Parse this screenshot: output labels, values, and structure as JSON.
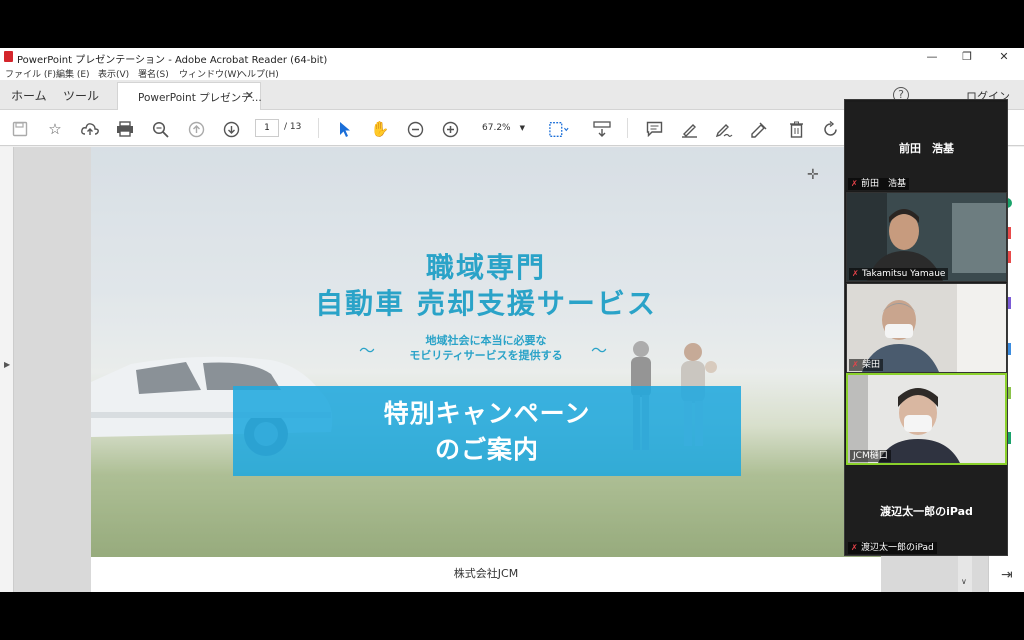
{
  "window": {
    "title": "PowerPoint プレゼンテーション - Adobe Acrobat Reader (64-bit)",
    "controls": {
      "minimize": "—",
      "restore": "❐",
      "close": "✕"
    }
  },
  "menu": [
    "ファイル (F)",
    "編集 (E)",
    "表示(V)",
    "署名(S)",
    "ウィンドウ(W)",
    "ヘルプ(H)"
  ],
  "tabs": {
    "home": "ホーム",
    "tools": "ツール",
    "document": "PowerPoint プレゼンテ...",
    "close": "✕",
    "help": "?",
    "login": "ログイン"
  },
  "toolbar": {
    "page_current": "1",
    "page_total": "/ 13",
    "zoom": "67.2%",
    "icons": [
      "save-icon",
      "star-icon",
      "cloud-upload-icon",
      "print-icon",
      "search-icon",
      "page-up-icon",
      "page-down-icon",
      "select-cursor-icon",
      "hand-icon",
      "zoom-out-icon",
      "zoom-in-icon",
      "fit-page-icon",
      "scroll-mode-icon",
      "comment-icon",
      "highlight-icon",
      "draw-icon",
      "sign-icon",
      "delete-icon",
      "rotate-icon"
    ]
  },
  "slide": {
    "title_line1": "職域専門",
    "title_line2": "自動車 売却支援サービス",
    "subtitle_line1": "地域社会に本当に必要な",
    "subtitle_line2": "モビリティサービスを提供する",
    "banner_line1": "特別キャンペーン",
    "banner_line2": "のご案内",
    "footer": "株式会社JCM",
    "accent_color": "#2aa3c8",
    "banner_color": "#21a8de"
  },
  "participants": [
    {
      "center_name": "前田　浩基",
      "label": "前田　浩基",
      "video": false,
      "muted": true
    },
    {
      "label": "Takamitsu Yamaue",
      "video": true,
      "muted": true
    },
    {
      "label": "柴田",
      "video": true,
      "muted": true
    },
    {
      "label": "JCM樋口",
      "video": true,
      "muted": false,
      "active": true
    },
    {
      "center_name": "渡辺太一郎のiPad",
      "label": "渡辺太一郎のiPad",
      "video": false,
      "muted": true
    }
  ]
}
